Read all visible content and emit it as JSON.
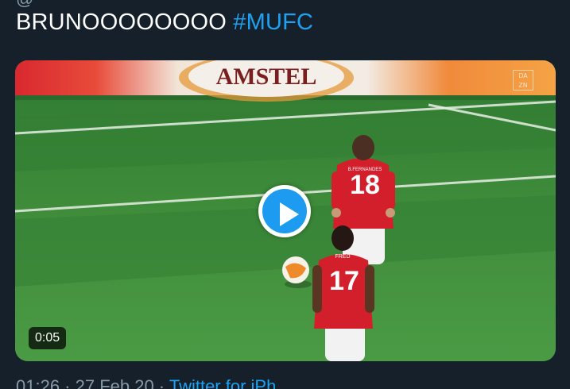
{
  "tweet": {
    "handle_fragment": "@",
    "text": "BRUNOOOOOOOO ",
    "hashtag": "#MUFC"
  },
  "media": {
    "ad_board_text": "AMSTEL",
    "watermark": "DA\nZN",
    "players": [
      {
        "number": "18",
        "name": "B.FERNANDES"
      },
      {
        "number": "17",
        "name": "FRED"
      }
    ],
    "duration": "0:05",
    "play_icon": "play-icon"
  },
  "meta": {
    "timestamp": "01:26 · 27 Feb 20 · ",
    "source": "Twitter for iPh"
  },
  "colors": {
    "background": "#15202b",
    "link": "#1da1f2",
    "play_accent": "#1d9bf0"
  }
}
